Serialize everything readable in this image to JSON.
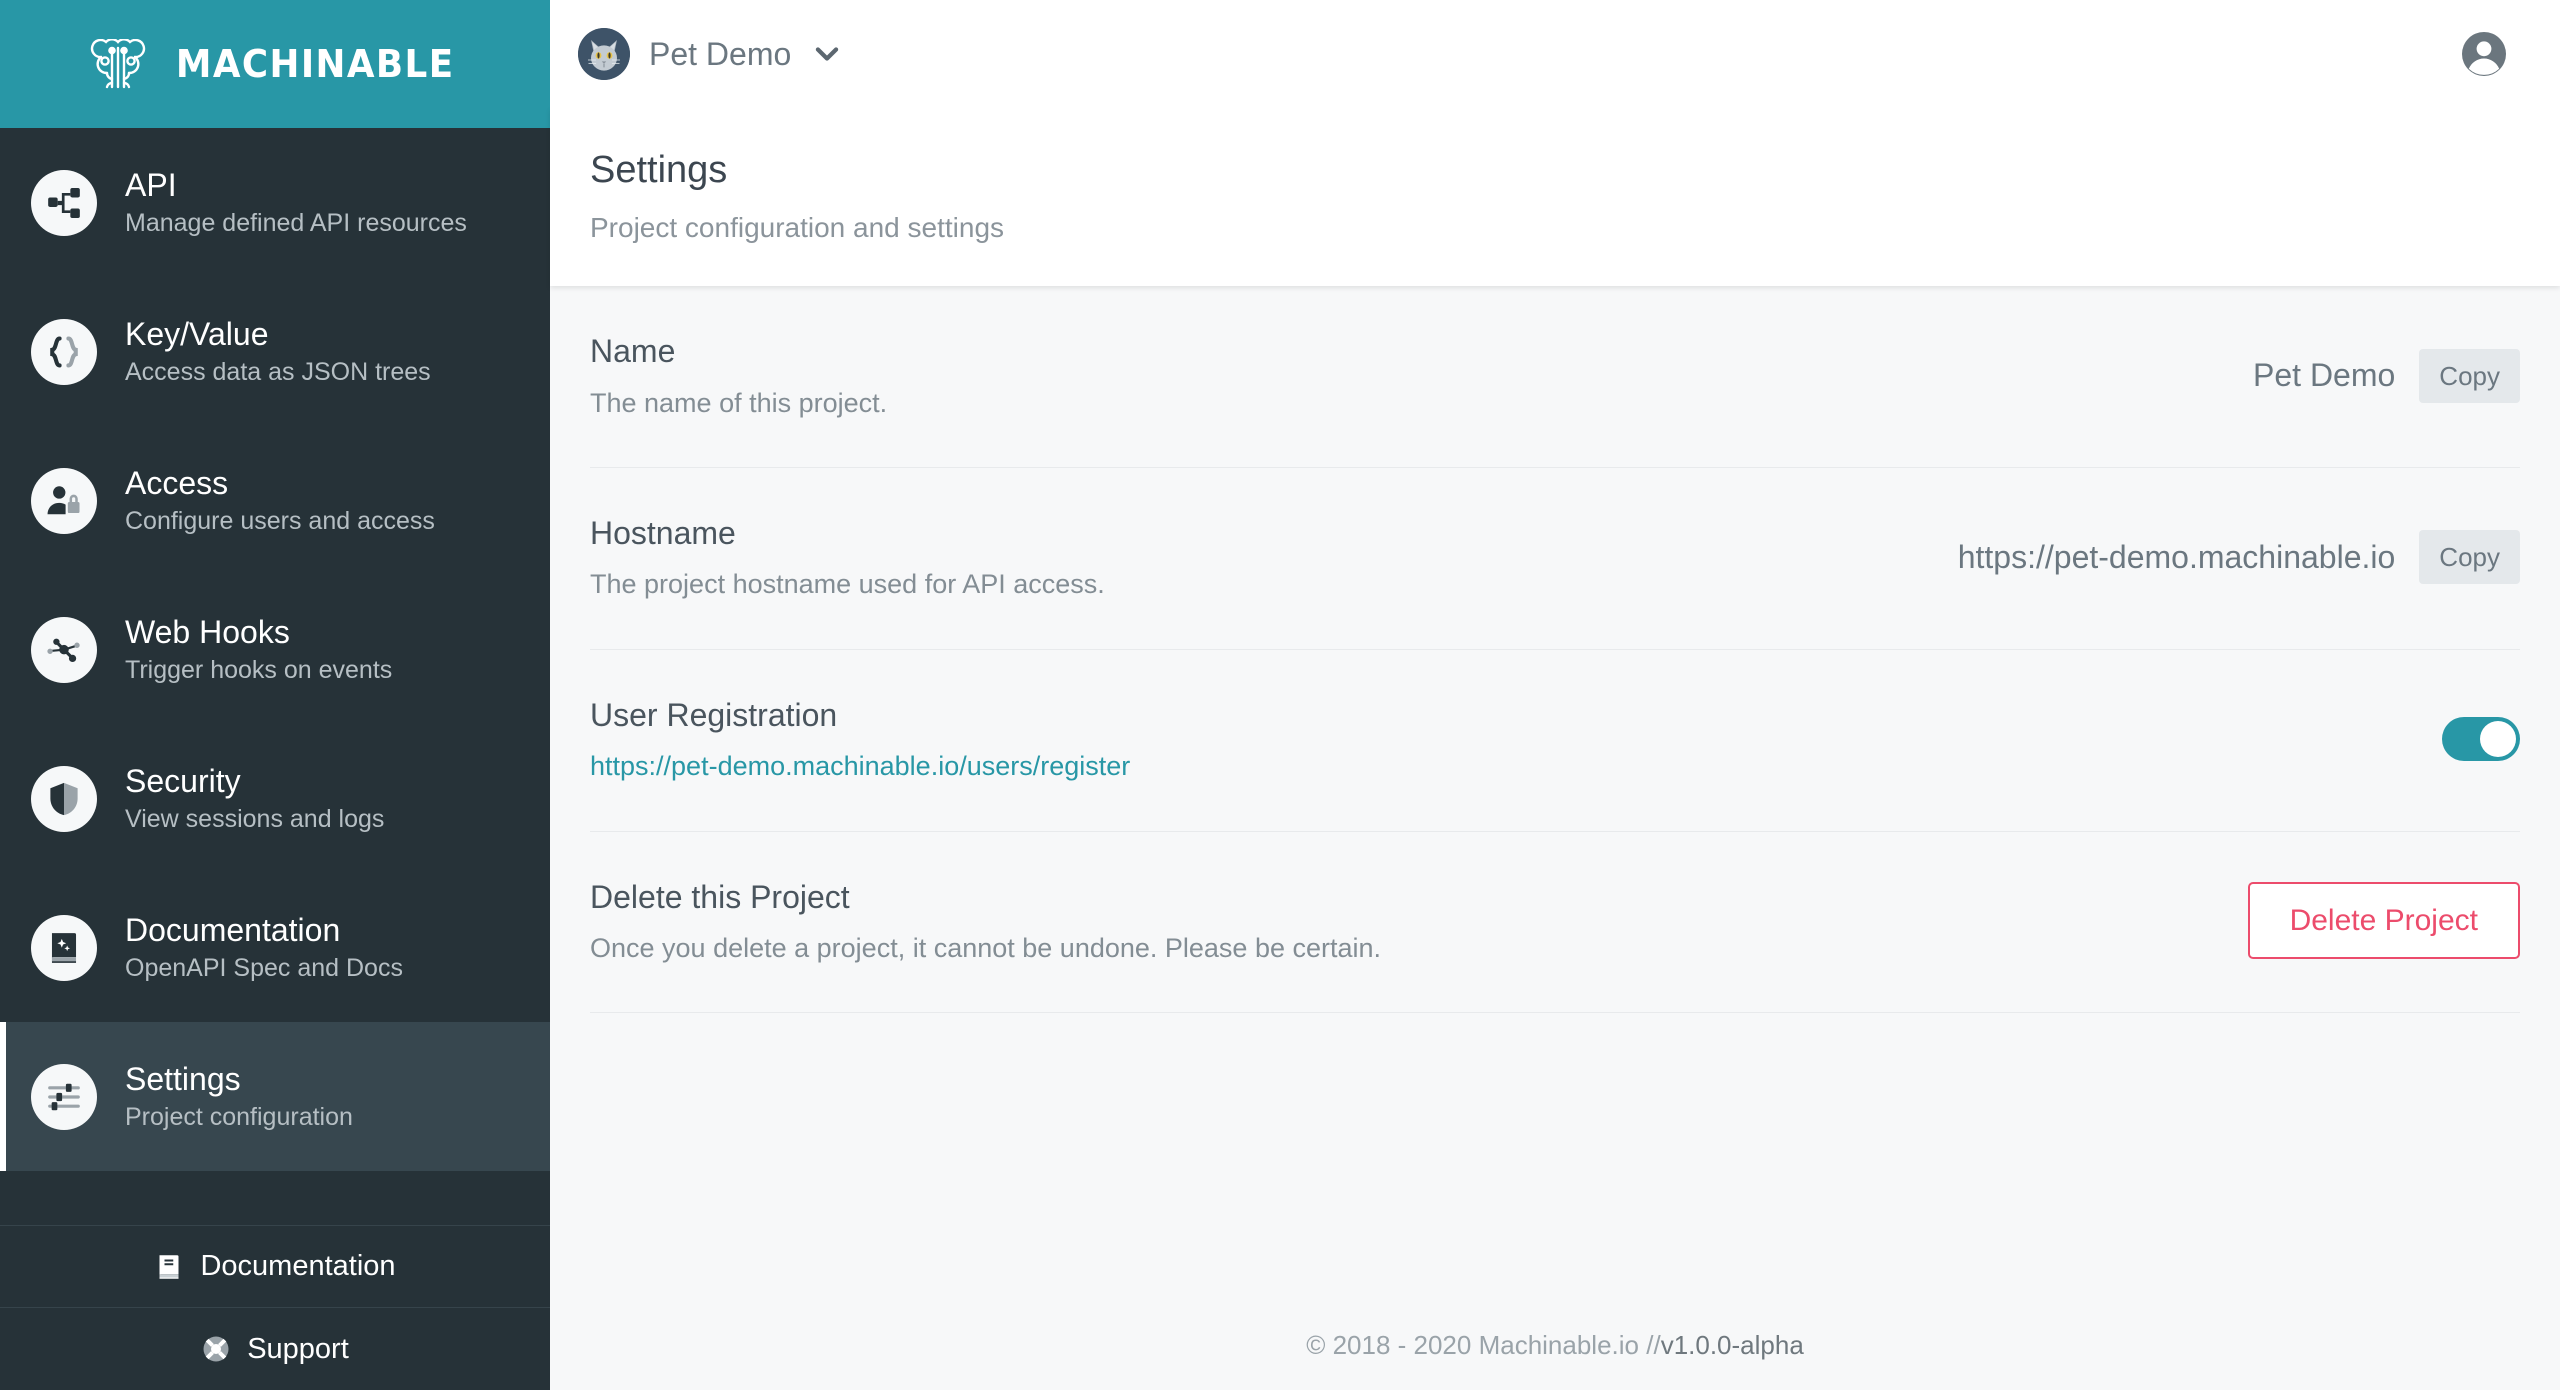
{
  "brand": {
    "name": "MACHINABLE",
    "logo_icon": "brain-tree-icon",
    "color": "#2897a6"
  },
  "sidebar": {
    "items": [
      {
        "title": "API",
        "subtitle": "Manage defined API resources",
        "icon": "api-nodes-icon",
        "active": false
      },
      {
        "title": "Key/Value",
        "subtitle": "Access data as JSON trees",
        "icon": "braces-icon",
        "active": false
      },
      {
        "title": "Access",
        "subtitle": "Configure users and access",
        "icon": "user-lock-icon",
        "active": false
      },
      {
        "title": "Web Hooks",
        "subtitle": "Trigger hooks on events",
        "icon": "webhook-nodes-icon",
        "active": false
      },
      {
        "title": "Security",
        "subtitle": "View sessions and logs",
        "icon": "shield-icon",
        "active": false
      },
      {
        "title": "Documentation",
        "subtitle": "OpenAPI Spec and Docs",
        "icon": "book-sparkle-icon",
        "active": false
      },
      {
        "title": "Settings",
        "subtitle": "Project configuration",
        "icon": "sliders-icon",
        "active": true
      }
    ],
    "bottom_links": [
      {
        "label": "Documentation",
        "icon": "book-icon"
      },
      {
        "label": "Support",
        "icon": "lifebuoy-icon"
      }
    ]
  },
  "topbar": {
    "project_name": "Pet Demo",
    "avatar_icon": "cat-avatar",
    "chevron_icon": "chevron-down-icon",
    "account_icon": "account-circle-icon"
  },
  "page": {
    "title": "Settings",
    "subtitle": "Project configuration and settings"
  },
  "settings": {
    "rows": [
      {
        "label": "Name",
        "description": "The name of this project.",
        "value": "Pet Demo",
        "action_label": "Copy"
      },
      {
        "label": "Hostname",
        "description": "The project hostname used for API access.",
        "value": "https://pet-demo.machinable.io",
        "action_label": "Copy"
      },
      {
        "label": "User Registration",
        "link": "https://pet-demo.machinable.io/users/register",
        "toggle_on": true,
        "toggle_color": "#2897a6"
      },
      {
        "label": "Delete this Project",
        "description": "Once you delete a project, it cannot be undone. Please be certain.",
        "action_label": "Delete Project",
        "action_color": "#ec4c6c"
      }
    ]
  },
  "footer": {
    "copyright": "© 2018 - 2020 Machinable.io // ",
    "version": "v1.0.0-alpha"
  }
}
